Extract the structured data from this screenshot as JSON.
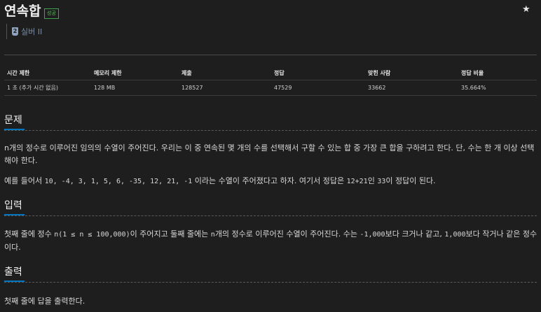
{
  "problem": {
    "title": "연속합",
    "status_badge": "성공",
    "star_icon": "★",
    "tier": {
      "icon_digit": "2",
      "label": "실버 II",
      "color": "#8da3c0"
    }
  },
  "stats": {
    "headers": [
      "시간 제한",
      "메모리 제한",
      "제출",
      "정답",
      "맞힌 사람",
      "정답 비율"
    ],
    "values": [
      "1 초 (추가 시간 없음)",
      "128 MB",
      "128527",
      "47529",
      "33662",
      "35.664%"
    ]
  },
  "sections": {
    "problem": {
      "title": "문제",
      "p1": "n개의 정수로 이루어진 임의의 수열이 주어진다. 우리는 이 중 연속된 몇 개의 수를 선택해서 구할 수 있는 합 중 가장 큰 합을 구하려고 한다. 단, 수는 한 개 이상 선택해야 한다.",
      "p2_pre": "예를 들어서 ",
      "p2_seq": "10, -4, 3, 1, 5, 6, -35, 12, 21, -1",
      "p2_mid": " 이라는 수열이 주어졌다고 하자. 여기서 정답은 ",
      "p2_ans": "12+21",
      "p2_mid2": "인 ",
      "p2_num": "33",
      "p2_post": "이 정답이 된다."
    },
    "input": {
      "title": "입력",
      "t1": "첫째 줄에 정수 ",
      "c1": "n(1 ≤ n ≤ 100,000)",
      "t2": "이 주어지고 둘째 줄에는 ",
      "c2": "n",
      "t3": "개의 정수로 이루어진 수열이 주어진다. 수는 ",
      "c3": "-1,000",
      "t4": "보다 크거나 같고, ",
      "c4": "1,000",
      "t5": "보다 작거나 같은 정수이다."
    },
    "output": {
      "title": "출력",
      "text": "첫째 줄에 답을 출력한다."
    }
  },
  "colors": {
    "accent": "#0076c0",
    "success": "#3fa34d",
    "background": "#1e1e1e"
  }
}
